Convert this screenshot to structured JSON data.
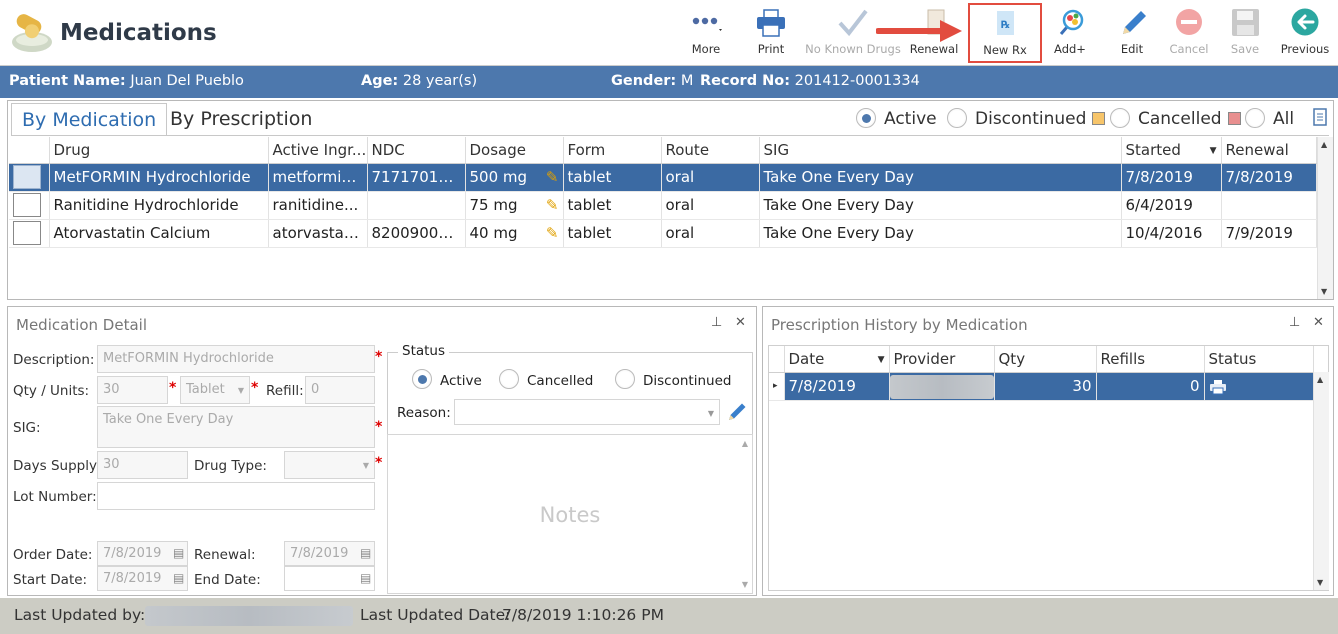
{
  "header": {
    "title": "Medications",
    "toolbar": {
      "more": "More",
      "print": "Print",
      "no_known_drugs": "No Known Drugs",
      "renewal": "Renewal",
      "new_rx": "New Rx",
      "add_plus": "Add+",
      "edit": "Edit",
      "cancel": "Cancel",
      "save": "Save",
      "previous": "Previous"
    }
  },
  "patient": {
    "name_label": "Patient Name:",
    "name": "Juan Del Pueblo",
    "age_label": "Age:",
    "age": "28 year(s)",
    "gender_label": "Gender:",
    "gender": "M",
    "record_label": "Record No:",
    "record_no": "201412-0001334"
  },
  "tabs": {
    "by_medication": "By Medication",
    "by_prescription": "By Prescription"
  },
  "filters": {
    "active": "Active",
    "discontinued": "Discontinued",
    "cancelled": "Cancelled",
    "all": "All",
    "selected": "Active",
    "discontinued_color": "#f7c56a",
    "cancelled_color": "#e88f8f"
  },
  "med_table": {
    "columns": [
      "Drug",
      "Active Ingr...",
      "NDC",
      "Dosage",
      "Form",
      "Route",
      "SIG",
      "Started",
      "Renewal"
    ],
    "rows": [
      {
        "drug": "MetFORMIN Hydrochloride",
        "ingredient": "metformin...",
        "ndc": "71717010...",
        "dosage": "500 mg",
        "form": "tablet",
        "route": "oral",
        "sig": "Take One Every Day",
        "started": "7/8/2019",
        "renewal": "7/8/2019"
      },
      {
        "drug": "Ranitidine Hydrochloride",
        "ingredient": "ranitidine...",
        "ndc": "",
        "dosage": "75 mg",
        "form": "tablet",
        "route": "oral",
        "sig": "Take One Every Day",
        "started": "6/4/2019",
        "renewal": ""
      },
      {
        "drug": "Atorvastatin Calcium",
        "ingredient": "atorvastati...",
        "ndc": "82009000...",
        "dosage": "40 mg",
        "form": "tablet",
        "route": "oral",
        "sig": "Take One Every Day",
        "started": "10/4/2016",
        "renewal": "7/9/2019"
      }
    ]
  },
  "detail": {
    "title": "Medication Detail",
    "description_label": "Description:",
    "description": "MetFORMIN Hydrochloride",
    "qty_label": "Qty / Units:",
    "qty": "30",
    "units": "Tablet",
    "refill_label": "Refill:",
    "refill": "0",
    "sig_label": "SIG:",
    "sig": "Take One Every Day",
    "days_supply_label": "Days Supply:",
    "days_supply": "30",
    "drug_type_label": "Drug Type:",
    "drug_type": "",
    "lot_label": "Lot Number:",
    "lot": "",
    "order_date_label": "Order Date:",
    "order_date": "7/8/2019",
    "renewal_label": "Renewal:",
    "renewal": "7/8/2019",
    "start_date_label": "Start Date:",
    "start_date": "7/8/2019",
    "end_date_label": "End Date:",
    "end_date": "",
    "status_label": "Status",
    "status_active": "Active",
    "status_cancelled": "Cancelled",
    "status_discontinued": "Discontinued",
    "status_selected": "Active",
    "reason_label": "Reason:",
    "notes_placeholder": "Notes"
  },
  "history": {
    "title": "Prescription History by Medication",
    "columns": [
      "Date",
      "Provider",
      "Qty",
      "Refills",
      "Status"
    ],
    "rows": [
      {
        "date": "7/8/2019",
        "provider": "",
        "qty": "30",
        "refills": "0",
        "status_icon": "printer-icon"
      }
    ]
  },
  "footer": {
    "updated_by_label": "Last Updated by:",
    "updated_by": "",
    "updated_date_label": "Last Updated Date:",
    "updated_date": "7/8/2019 1:10:26 PM"
  },
  "colors": {
    "header_bar": "#4d78ad",
    "selected_row": "#3b6aa3",
    "highlight_border": "#e24c3f",
    "footer_bg": "#ccccc4"
  }
}
